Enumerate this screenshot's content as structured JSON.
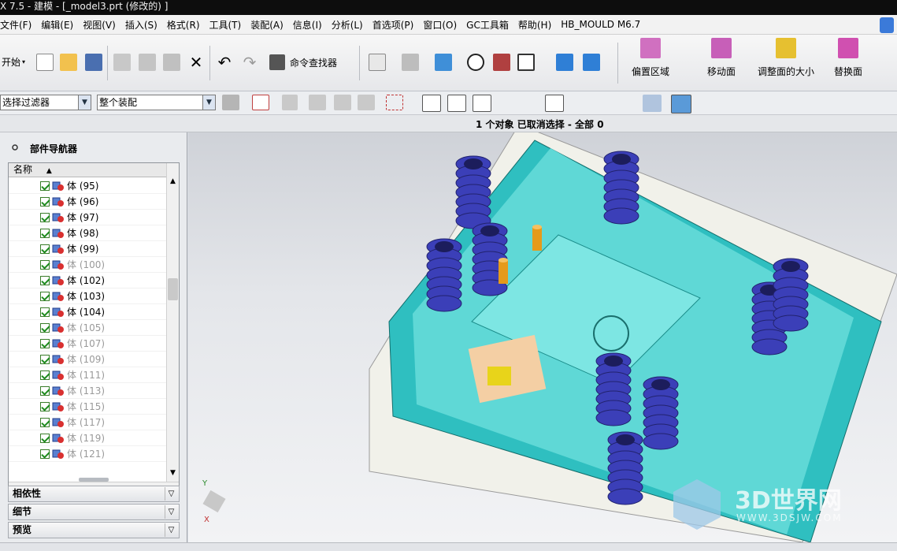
{
  "window": {
    "title": "X 7.5 - 建模 - [_model3.prt  (修改的) ]"
  },
  "menu": [
    "文件(F)",
    "编辑(E)",
    "视图(V)",
    "插入(S)",
    "格式(R)",
    "工具(T)",
    "装配(A)",
    "信息(I)",
    "分析(L)",
    "首选项(P)",
    "窗口(O)",
    "GC工具箱",
    "帮助(H)",
    "HB_MOULD M6.7"
  ],
  "toolbar": {
    "start_label": "开始",
    "command_finder_label": "命令查找器",
    "big_buttons": [
      "偏置区域",
      "移动面",
      "调整面的大小",
      "替换面"
    ]
  },
  "selection": {
    "filter_label": "选择过滤器",
    "scope_label": "整个装配"
  },
  "status": {
    "text": "1 个对象 已取消选择  - 全部 0"
  },
  "navigator": {
    "title": "部件导航器",
    "column_name": "名称",
    "items": [
      {
        "label": "体 (95)",
        "active": true
      },
      {
        "label": "体 (96)",
        "active": true
      },
      {
        "label": "体 (97)",
        "active": true
      },
      {
        "label": "体 (98)",
        "active": true
      },
      {
        "label": "体 (99)",
        "active": true
      },
      {
        "label": "体 (100)",
        "active": false
      },
      {
        "label": "体 (102)",
        "active": true
      },
      {
        "label": "体 (103)",
        "active": true
      },
      {
        "label": "体 (104)",
        "active": true
      },
      {
        "label": "体 (105)",
        "active": false
      },
      {
        "label": "体 (107)",
        "active": false
      },
      {
        "label": "体 (109)",
        "active": false
      },
      {
        "label": "体 (111)",
        "active": false
      },
      {
        "label": "体 (113)",
        "active": false
      },
      {
        "label": "体 (115)",
        "active": false
      },
      {
        "label": "体 (117)",
        "active": false
      },
      {
        "label": "体 (119)",
        "active": false
      },
      {
        "label": "体 (121)",
        "active": false
      }
    ],
    "sections": [
      "相依性",
      "细节",
      "预览"
    ]
  },
  "viewport": {
    "triad_labels": {
      "y": "Y",
      "x": "X"
    },
    "watermark": {
      "brand": "3D世界网",
      "url": "WWW.3DSJW.COM"
    }
  },
  "colors": {
    "plate": "#2fbfc0",
    "spring": "#3b3fb8",
    "pin": "#e59a1a",
    "base": "#f1f1ea"
  }
}
